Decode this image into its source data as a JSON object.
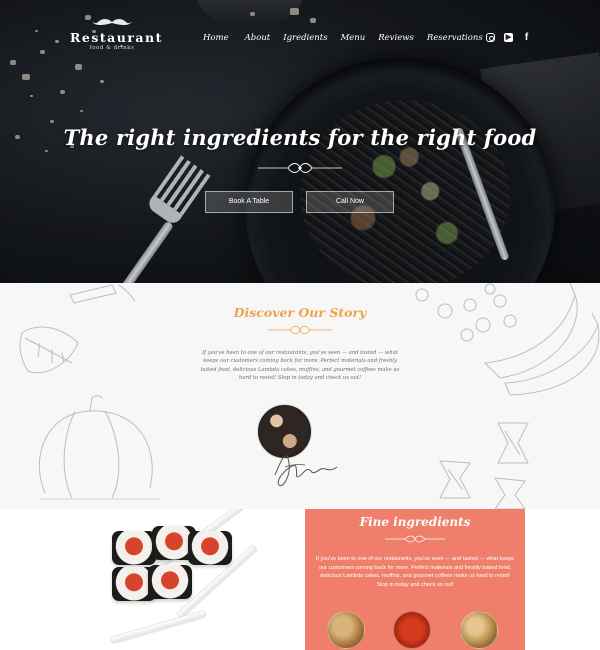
{
  "brand": {
    "name": "Restaurant",
    "tagline": "food & drinks"
  },
  "nav": {
    "items": [
      "Home",
      "About",
      "Igredients",
      "Menu",
      "Reviews",
      "Reservations"
    ]
  },
  "social": {
    "icons": [
      "instagram-icon",
      "youtube-icon",
      "facebook-icon"
    ]
  },
  "hero": {
    "headline": "The right ingredients for the right food",
    "book_label": "Book A Table",
    "call_label": "Call Now"
  },
  "story": {
    "title": "Discover Our Story",
    "text": "If you've been to one of our restaurants, you've seen — and tasted — what keeps our customers coming back for more. Perfect materials and freshly baked food, delicious Lambda cakes, muffins, and gourmet coffees make us hard to resist! Stop in today and check us out!"
  },
  "fine": {
    "title": "Fine ingredients",
    "text": "If you've been to one of our restaurants, you've seen — and tasted — what keeps our customers coming back for more. Perfect materials and freshly baked food, delicious Lambda cakes, muffins, and gourmet coffees make us hard to resist! Stop in today and check us out!"
  },
  "colors": {
    "accent": "#f0a24a",
    "coral": "#ef7f6a",
    "hero_dark": "#16191e"
  }
}
